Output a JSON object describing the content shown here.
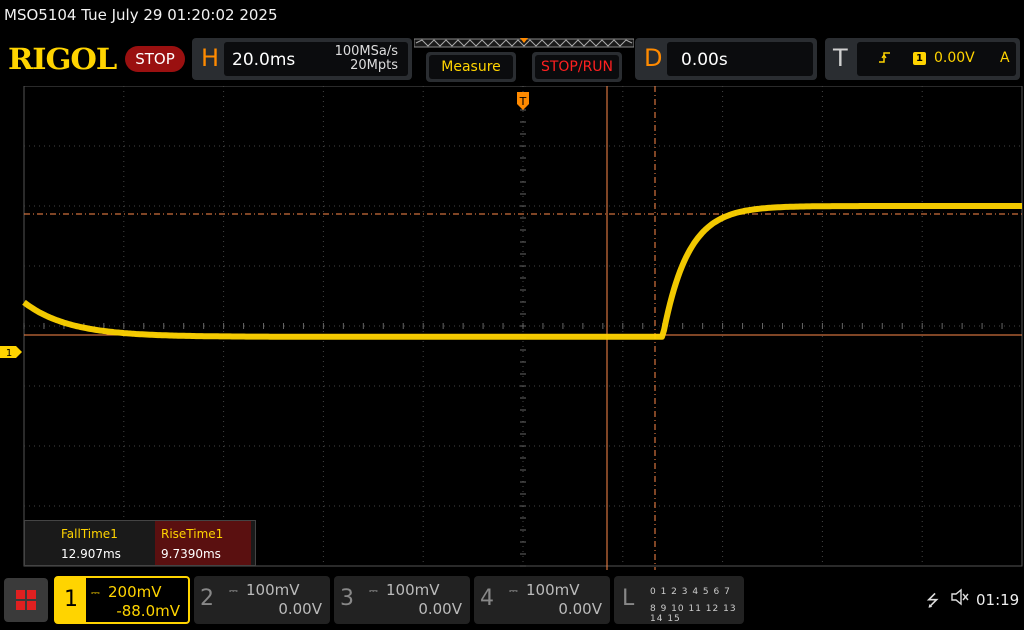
{
  "header": {
    "title": "MSO5104  Tue July 29 01:20:02 2025",
    "logo": "RIGOL",
    "status": "STOP"
  },
  "horizontal": {
    "letter": "H",
    "timebase": "20.0ms",
    "sample_rate": "100MSa/s",
    "memory_depth": "20Mpts"
  },
  "buttons": {
    "measure": "Measure",
    "stop_run": "STOP/RUN"
  },
  "delay": {
    "letter": "D",
    "value": "0.00s"
  },
  "trigger": {
    "letter": "T",
    "edge_icon": "rising-edge-icon",
    "source": "1",
    "level": "0.00V",
    "mode": "A"
  },
  "screen": {
    "channel_marker": "1",
    "trace_color": "#ffd400",
    "cursor_color": "#ff8a4a",
    "waveform": {
      "high_level_div": 2.0,
      "low_level_div": -0.18,
      "fall_start_div": -5.6,
      "fall_tau_div": 0.45,
      "rise_start_div": 1.4,
      "rise_tau_div": 0.25
    }
  },
  "measurements": [
    {
      "name": "FallTime1",
      "value": "12.907ms"
    },
    {
      "name": "RiseTime1",
      "value": "9.7390ms"
    }
  ],
  "channels": [
    {
      "num": "1",
      "scale": "200mV",
      "offset": "-88.0mV",
      "active": true
    },
    {
      "num": "2",
      "scale": "100mV",
      "offset": "0.00V",
      "active": false
    },
    {
      "num": "3",
      "scale": "100mV",
      "offset": "0.00V",
      "active": false
    },
    {
      "num": "4",
      "scale": "100mV",
      "offset": "0.00V",
      "active": false
    }
  ],
  "logic": {
    "letter": "L",
    "row1": "0 1 2 3  4 5 6 7",
    "row2": "8 9 10 11 12 13 14 15"
  },
  "status_bar": {
    "usb_icon": "usb-icon",
    "speaker_icon": "speaker-muted-icon",
    "time": "01:19"
  }
}
